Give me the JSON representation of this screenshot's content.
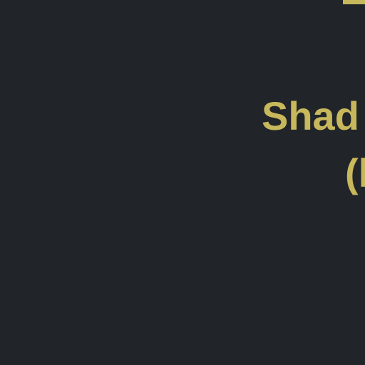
{
  "colors": {
    "background": "#212529",
    "accent": "#c8b85c"
  },
  "heading": {
    "line1": "Shad",
    "line2": "(l"
  }
}
